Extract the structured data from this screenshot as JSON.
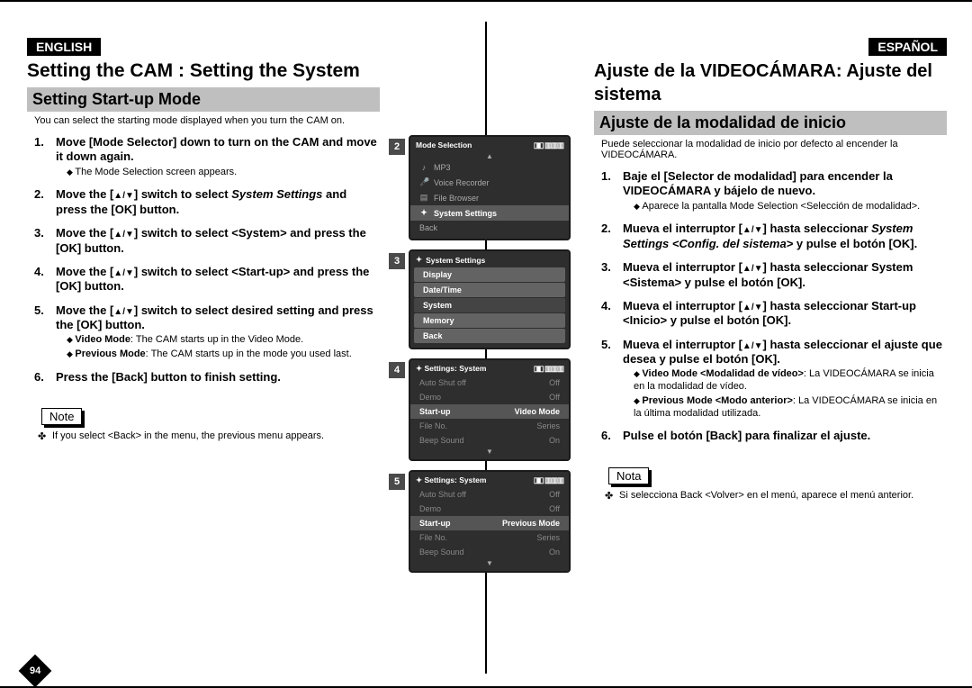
{
  "pageNumber": "94",
  "english": {
    "langTag": "ENGLISH",
    "title": "Setting the CAM : Setting the System",
    "sectionBar": "Setting Start-up Mode",
    "intro": "You can select the starting mode displayed when you turn the CAM on.",
    "steps": {
      "s1": "Move [Mode Selector] down to turn on the CAM and move it down again.",
      "s1sub": "The Mode Selection screen appears.",
      "s2a": "Move the [",
      "s2b": "] switch to select",
      "s2c": "System Settings",
      "s2d": " and press the [OK] button.",
      "s3a": "Move the [",
      "s3b": "] switch to select <System> and press the [OK] button.",
      "s4a": "Move the [",
      "s4b": "] switch to select <Start-up> and press the [OK] button.",
      "s5a": "Move the [",
      "s5b": "] switch to select desired setting and press the [OK] button.",
      "s5sub1a": "Video Mode",
      "s5sub1b": ": The CAM starts up in the Video Mode.",
      "s5sub2a": "Previous Mode",
      "s5sub2b": ": The CAM starts up in the mode you used last.",
      "s6": "Press the [Back] button to finish setting."
    },
    "noteLabel": "Note",
    "noteBody": "If you select <Back> in the menu, the previous menu appears."
  },
  "spanish": {
    "langTag": "ESPAÑOL",
    "title": "Ajuste de la VIDEOCÁMARA: Ajuste del sistema",
    "sectionBar": "Ajuste de la modalidad de inicio",
    "intro": "Puede seleccionar la modalidad de inicio por defecto al encender la VIDEOCÁMARA.",
    "steps": {
      "s1": "Baje el [Selector de modalidad] para encender la VIDEOCÁMARA y bájelo de nuevo.",
      "s1sub": "Aparece la pantalla Mode Selection <Selección de modalidad>.",
      "s2a": "Mueva el interruptor [",
      "s2b": "] hasta seleccionar ",
      "s2c": "System Settings <Config. del sistema>",
      "s2d": " y pulse el botón [OK].",
      "s3a": "Mueva el interruptor [",
      "s3b": "] hasta seleccionar System <Sistema> y pulse el botón [OK].",
      "s4a": "Mueva el interruptor [",
      "s4b": "] hasta seleccionar Start-up <Inicio> y pulse el botón [OK].",
      "s5a": "Mueva el interruptor [",
      "s5b": "] hasta seleccionar el ajuste que desea y pulse el botón [OK].",
      "s5sub1a": "Video Mode <Modalidad de vídeo>",
      "s5sub1b": ": La VIDEOCÁMARA se inicia en la modalidad de vídeo.",
      "s5sub2a": "Previous Mode <Modo anterior>",
      "s5sub2b": ": La VIDEOCÁMARA se inicia en la última modalidad utilizada.",
      "s6": "Pulse el botón [Back] para finalizar el ajuste."
    },
    "noteLabel": "Nota",
    "noteBody": "Si selecciona Back <Volver> en el menú, aparece el menú anterior."
  },
  "screens": {
    "updown": "▲/▼",
    "s2": {
      "num": "2",
      "title": "Mode Selection",
      "statusA": "▯◧",
      "statusB": "▥▥▥",
      "item1": "MP3",
      "item2": "Voice Recorder",
      "item3": "File Browser",
      "sel": "System Settings",
      "back": "Back"
    },
    "s3": {
      "num": "3",
      "title": "System Settings",
      "b1": "Display",
      "b2": "Date/Time",
      "b3": "System",
      "b4": "Memory",
      "b5": "Back"
    },
    "s4": {
      "num": "4",
      "title": "Settings: System",
      "statusA": "▯◧",
      "statusB": "▥▥▥",
      "r1a": "Auto Shut off",
      "r1b": "Off",
      "r2a": "Demo",
      "r2b": "Off",
      "r3a": "Start-up",
      "r3b": "Video Mode",
      "r4a": "File No.",
      "r4b": "Series",
      "r5a": "Beep Sound",
      "r5b": "On"
    },
    "s5": {
      "num": "5",
      "title": "Settings: System",
      "statusA": "▯◧",
      "statusB": "▥▥▥",
      "r1a": "Auto Shut off",
      "r1b": "Off",
      "r2a": "Demo",
      "r2b": "Off",
      "r3a": "Start-up",
      "r3b": "Previous Mode",
      "r4a": "File No.",
      "r4b": "Series",
      "r5a": "Beep Sound",
      "r5b": "On"
    }
  }
}
